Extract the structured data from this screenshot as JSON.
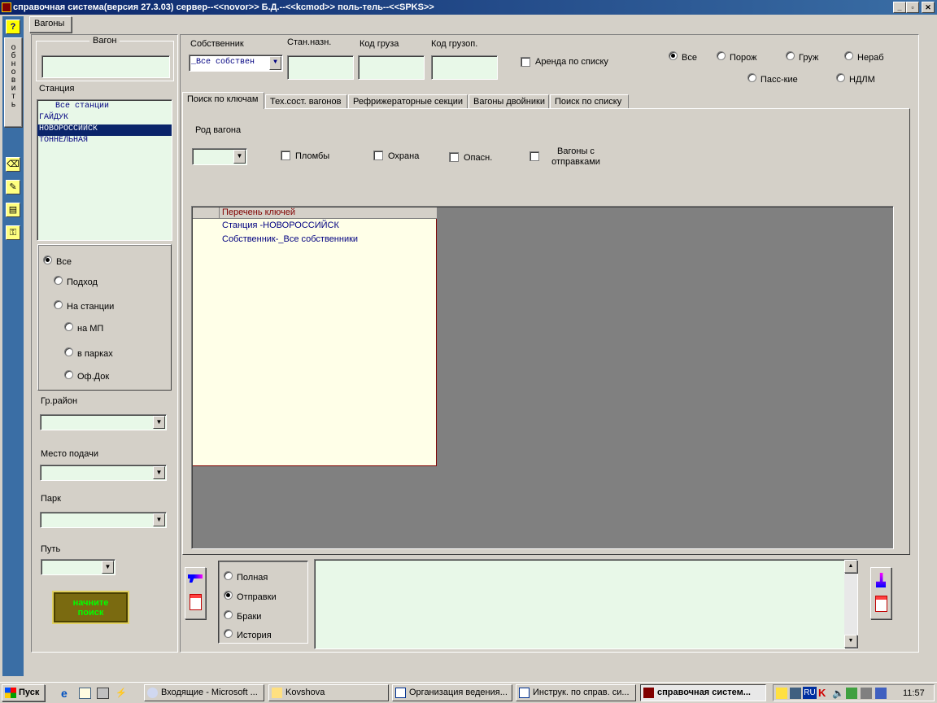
{
  "window": {
    "title": "справочная система(версия 27.3.03) сервер--<<novor>> Б.Д.--<<kcmod>> поль-тель--<<SPKS>>"
  },
  "sidebar": {
    "help_label": "?",
    "refresh_label": "обновить"
  },
  "outer_tab": {
    "label": "Вагоны"
  },
  "left_panel": {
    "wagon_group": "Вагон",
    "wagon_value": "",
    "station_label": "Станция",
    "stations": [
      "Все станции",
      "ГАЙДУК",
      "НОВОРОССИЙСК",
      "ТОННЕЛЬНАЯ"
    ],
    "selected_station": "НОВОРОССИЙСК",
    "radios": [
      "Все",
      "Подход",
      "На станции",
      "на МП",
      "в парках",
      "Оф.Док"
    ],
    "radio_selected": "Все",
    "gr_raion_label": "Гр.район",
    "mesto_label": "Место подачи",
    "park_label": "Парк",
    "put_label": "Путь",
    "start_button": "начните поиск"
  },
  "top_filters": {
    "owner_label": "Собственник",
    "owner_value": "_Все собствен",
    "dest_label": "Стан.назн.",
    "cargo_label": "Код груза",
    "shipper_label": "Код грузоп.",
    "lease_label": "Аренда по списку",
    "load_radios": [
      "Все",
      "Порож",
      "Груж",
      "Нераб",
      "Пасс-кие",
      "НДЛМ"
    ],
    "load_selected": "Все"
  },
  "tabs": [
    "Поиск по ключам",
    "Тех.сост. вагонов",
    "Рефрижераторные секции",
    "Вагоны двойники",
    "Поиск по списку"
  ],
  "active_tab": "Поиск по ключам",
  "keys_tab": {
    "wagon_kind_label": "Род вагона",
    "checks": [
      "Пломбы",
      "Охрана",
      "Опасн.",
      "Вагоны с отправками"
    ],
    "grid_header": "Перечень ключей",
    "grid_rows": [
      "Станция -НОВОРОССИЙСК",
      "Собственник-_Все собственники"
    ]
  },
  "bottom": {
    "mode_radios": [
      "Полная",
      "Отправки",
      "Браки",
      "История"
    ],
    "mode_selected": "Отправки"
  },
  "taskbar": {
    "start": "Пуск",
    "tasks": [
      "Входящие - Microsoft ...",
      "Kovshova",
      "Организация ведения...",
      "Инструк. по справ. си...",
      "справочная систем..."
    ],
    "lang": "RU",
    "clock": "11:57"
  }
}
